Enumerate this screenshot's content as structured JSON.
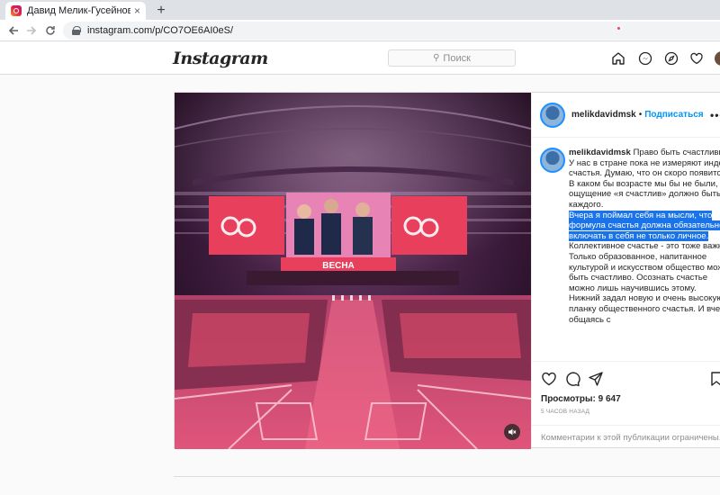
{
  "browser": {
    "tab_title": "Давид Мелик-Гусейнов в Instag",
    "tab_close": "×",
    "new_tab": "+",
    "url": "instagram.com/p/CO7OE6AI0eS/"
  },
  "header": {
    "logo": "Instagram",
    "search_placeholder": "Поиск",
    "accent_notification": "#ed4956"
  },
  "post": {
    "username": "melikdavidmsk",
    "separator": "•",
    "follow_label": "Подписаться",
    "more": "•••",
    "stage_banner": "ВЕСНА",
    "caption_user": "melikdavidmsk",
    "caption_part1": "Право быть счастливым.\nУ нас в стране пока не измеряют индекс счастья. Думаю, что он скоро появится. В каком бы возрасте мы бы не были, ощущение «я счастлив» должно быть у каждого.",
    "caption_highlight": "Вчера я поймал себя на мысли, что формула счастья должна обязательно включать в себя не только личное.",
    "caption_part2": " Коллективное счастье - это тоже важно. Только образованное, напитанное культурой и искусством общество может быть счастливо. Осознать счастье можно лишь научившись этому.\nНижний задал новую и очень высокую планку общественного счастья. И вчера, общаясь с",
    "views": "Просмотры: 9 647",
    "time": "5 ЧАСОВ НАЗАД",
    "comments_disabled": "Комментарии к этой публикации ограничены."
  },
  "colors": {
    "link_blue": "#0095f6",
    "selection": "#1a73e8",
    "screen_pink": "#e8405c"
  }
}
